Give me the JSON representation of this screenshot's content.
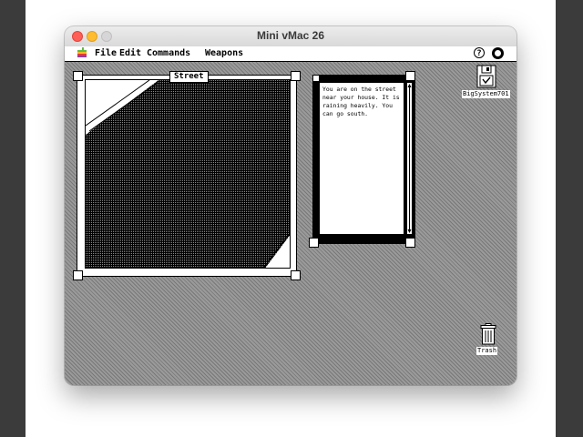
{
  "host": {
    "title": "Mini vMac 26"
  },
  "menubar": {
    "apple_icon": "apple-logo-icon",
    "items": [
      "File",
      "Edit",
      "Commands",
      "Weapons"
    ],
    "help_glyph": "?",
    "right_icons": [
      "help-icon",
      "application-menu-icon"
    ]
  },
  "street_window": {
    "title": "Street"
  },
  "text_window": {
    "message": "You are on the street near your house.  It is raining heavily. You can go south."
  },
  "desktop": {
    "disk_label": "BigSystem701",
    "trash_label": "Trash"
  },
  "colors": {
    "desktop_pattern": "#9a9a9a",
    "close_button": "#fe5f57",
    "minimize_button": "#febc2e"
  }
}
